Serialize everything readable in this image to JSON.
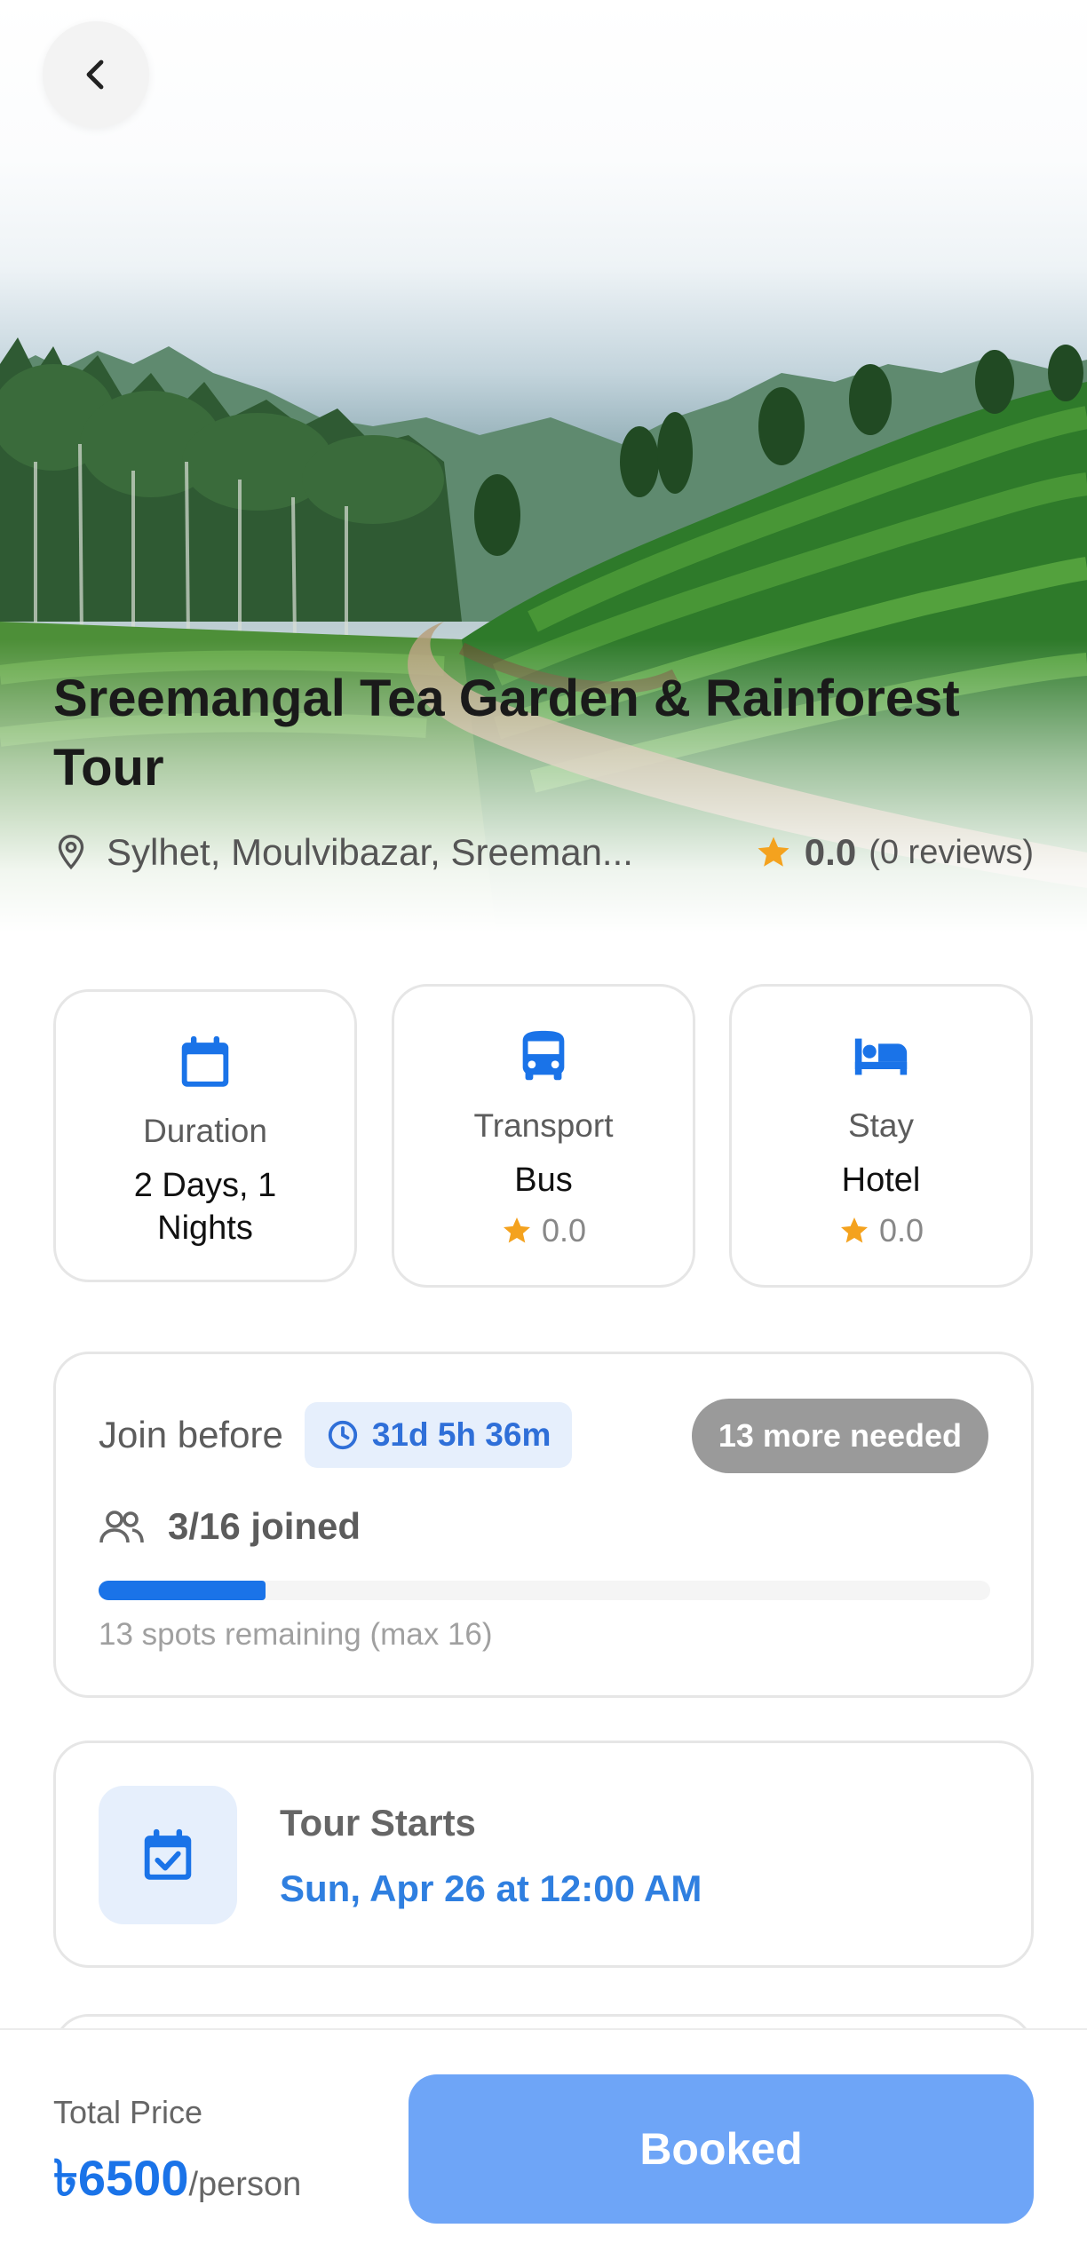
{
  "colors": {
    "accent": "#1a73e8",
    "accent_light": "#e6effc",
    "star": "#f4a21e",
    "badge_gray": "#9a9a9a",
    "button_disabled": "#6ea5f7"
  },
  "header": {
    "back_icon": "chevron-left-icon",
    "title": "Sreemangal Tea Garden & Rainforest Tour",
    "location": "Sylhet, Moulvibazar, Sreeman...",
    "location_icon": "map-pin-icon",
    "rating": "0.0",
    "reviews": "(0 reviews)"
  },
  "info_cards": [
    {
      "icon": "calendar-icon",
      "label": "Duration",
      "value": "2 Days, 1 Nights"
    },
    {
      "icon": "bus-icon",
      "label": "Transport",
      "value": "Bus",
      "rating": "0.0"
    },
    {
      "icon": "bed-icon",
      "label": "Stay",
      "value": "Hotel",
      "rating": "0.0"
    }
  ],
  "join": {
    "label": "Join before",
    "countdown": "31d 5h 36m",
    "needed_badge": "13 more needed",
    "joined": "3/16 joined",
    "progress": 0.1875,
    "remaining": "13 spots remaining (max 16)"
  },
  "tour_start": {
    "label": "Tour Starts",
    "value": "Sun, Apr 26 at 12:00 AM"
  },
  "footer": {
    "total_label": "Total Price",
    "price": "৳6500",
    "per": "/person",
    "button": "Booked"
  }
}
